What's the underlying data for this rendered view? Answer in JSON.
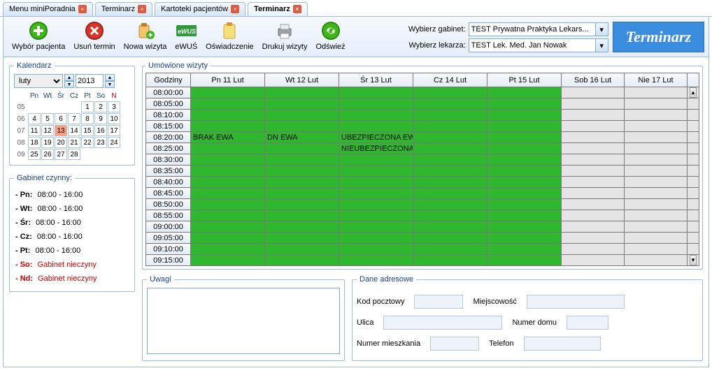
{
  "tabs": [
    {
      "label": "Menu miniPoradnia",
      "closable": true,
      "active": false
    },
    {
      "label": "Terminarz",
      "closable": true,
      "active": false
    },
    {
      "label": "Kartoteki pacjentów",
      "closable": true,
      "active": false
    },
    {
      "label": "Terminarz",
      "closable": true,
      "active": true
    }
  ],
  "toolbar": {
    "select_patient": "Wybór pacjenta",
    "delete_visit": "Usuń termin",
    "new_visit": "Nowa wizyta",
    "ewus": "eWUŚ",
    "declaration": "Oświadczenie",
    "print_visits": "Drukuj wizyty",
    "refresh": "Odśwież",
    "lbl_cabinet": "Wybierz gabinet:",
    "lbl_doctor": "Wybierz lekarza:",
    "sel_cabinet": "TEST Prywatna Praktyka Lekars...",
    "sel_doctor": "TEST Lek. Med. Jan Nowak",
    "brand": "Terminarz"
  },
  "calendar": {
    "legend": "Kalendarz",
    "month": "luty",
    "year": "2013",
    "dow": [
      "Pn",
      "Wt",
      "Śr",
      "Cz",
      "Pt",
      "So",
      "N"
    ],
    "weeks": [
      {
        "wk": "05",
        "days": [
          "",
          "",
          "",
          "",
          "1",
          "2",
          "3"
        ]
      },
      {
        "wk": "06",
        "days": [
          "4",
          "5",
          "6",
          "7",
          "8",
          "9",
          "10"
        ]
      },
      {
        "wk": "07",
        "days": [
          "11",
          "12",
          "13",
          "14",
          "15",
          "16",
          "17"
        ],
        "selected_idx": 2
      },
      {
        "wk": "08",
        "days": [
          "18",
          "19",
          "20",
          "21",
          "22",
          "23",
          "24"
        ]
      },
      {
        "wk": "09",
        "days": [
          "25",
          "26",
          "27",
          "28",
          "",
          "",
          ""
        ]
      }
    ]
  },
  "hours": {
    "legend": "Gabinet czynny:",
    "items": [
      {
        "day": "- Pn:",
        "text": "08:00 - 16:00",
        "closed": false
      },
      {
        "day": "- Wt:",
        "text": "08:00 - 16:00",
        "closed": false
      },
      {
        "day": "- Śr:",
        "text": "08:00 - 16:00",
        "closed": false
      },
      {
        "day": "- Cz:",
        "text": "08:00 - 16:00",
        "closed": false
      },
      {
        "day": "- Pt:",
        "text": "08:00 - 16:00",
        "closed": false
      },
      {
        "day": "- So:",
        "text": "Gabinet nieczyny",
        "closed": true
      },
      {
        "day": "- Nd:",
        "text": "Gabinet nieczyny",
        "closed": true
      }
    ]
  },
  "schedule": {
    "legend": "Umówione wizyty",
    "col_time": "Godziny",
    "days": [
      "Pn 11 Lut",
      "Wt 12 Lut",
      "Śr 13 Lut",
      "Cz 14 Lut",
      "Pt 15 Lut",
      "Sob 16 Lut",
      "Nie 17 Lut"
    ],
    "weekday_count": 5,
    "times": [
      "08:00:00",
      "08:05:00",
      "08:10:00",
      "08:15:00",
      "08:20:00",
      "08:25:00",
      "08:30:00",
      "08:35:00",
      "08:40:00",
      "08:45:00",
      "08:50:00",
      "08:55:00",
      "09:00:00",
      "09:05:00",
      "09:10:00",
      "09:15:00"
    ],
    "appointments": {
      "4": {
        "0": "BRAK EWA",
        "1": "DN EWA",
        "2": "UBEZPIECZONA EWA"
      },
      "5": {
        "2": "NIEUBEZPIECZONA EWA"
      }
    }
  },
  "notes": {
    "legend": "Uwagi",
    "value": ""
  },
  "address": {
    "legend": "Dane adresowe",
    "lbl_zip": "Kod pocztowy",
    "lbl_city": "Miejscowość",
    "lbl_street": "Ulica",
    "lbl_house": "Numer domu",
    "lbl_apt": "Numer mieszkania",
    "lbl_phone": "Telefon",
    "zip": "",
    "city": "",
    "street": "",
    "house": "",
    "apt": "",
    "phone": ""
  }
}
